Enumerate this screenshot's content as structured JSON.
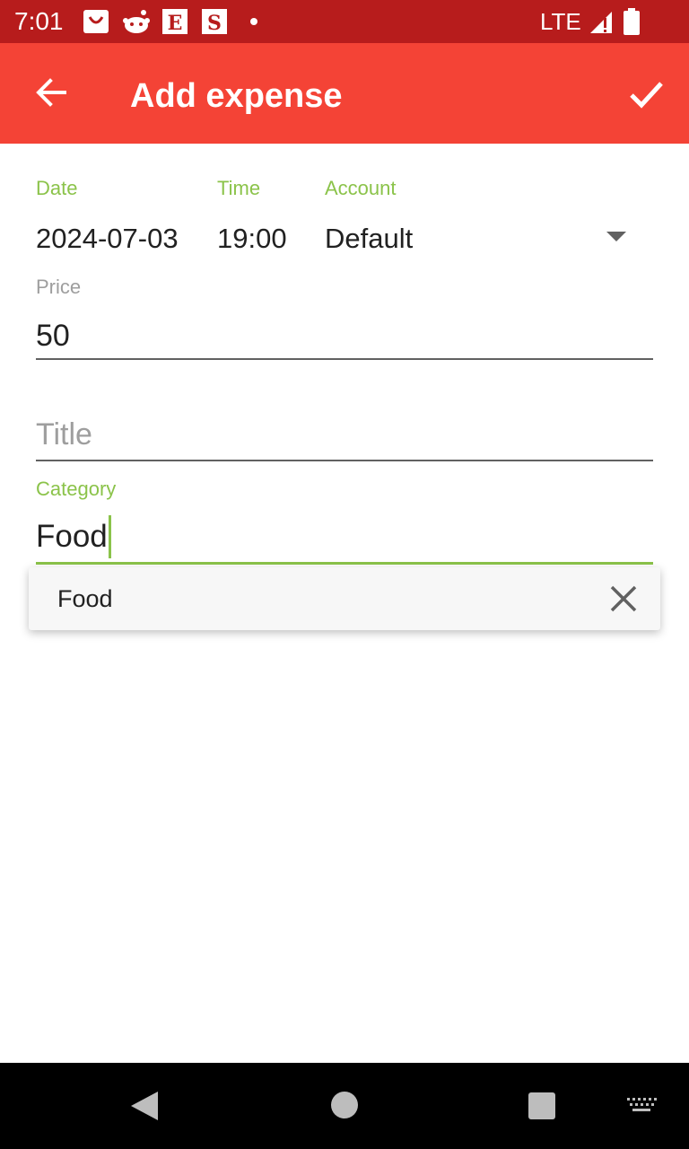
{
  "status_bar": {
    "time": "7:01",
    "network": "LTE",
    "notification_icons": [
      "shopping-bag-icon",
      "reddit-icon",
      "etsy-icon",
      "s-app-icon"
    ],
    "etsy_letter": "E",
    "s_letter": "S"
  },
  "app_bar": {
    "title": "Add expense",
    "back_icon": "arrow-back-icon",
    "confirm_icon": "check-icon"
  },
  "form": {
    "date": {
      "label": "Date",
      "value": "2024-07-03"
    },
    "time": {
      "label": "Time",
      "value": "19:00"
    },
    "account": {
      "label": "Account",
      "value": "Default"
    },
    "price": {
      "label": "Price",
      "value": "50"
    },
    "title": {
      "placeholder": "Title",
      "value": ""
    },
    "category": {
      "label": "Category",
      "value": "Food"
    }
  },
  "suggestions": [
    {
      "text": "Food"
    }
  ],
  "colors": {
    "status_bar": "#b71c1c",
    "app_bar": "#f44336",
    "accent": "#8bc34a"
  }
}
